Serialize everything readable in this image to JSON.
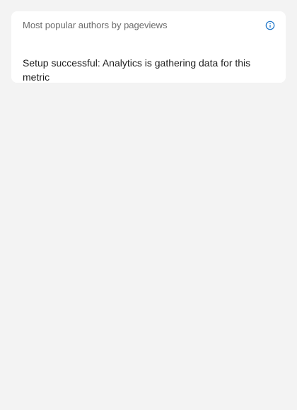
{
  "widget": {
    "title": "Most popular authors by pageviews",
    "info_icon": "info-circle-icon",
    "message": "Setup successful: Analytics is gathering data for this metric"
  },
  "colors": {
    "background": "#f3f3f3",
    "card": "#ffffff",
    "title_text": "#6b6b6b",
    "body_text": "#1e1e1e",
    "info_icon": "#1a73c8"
  }
}
